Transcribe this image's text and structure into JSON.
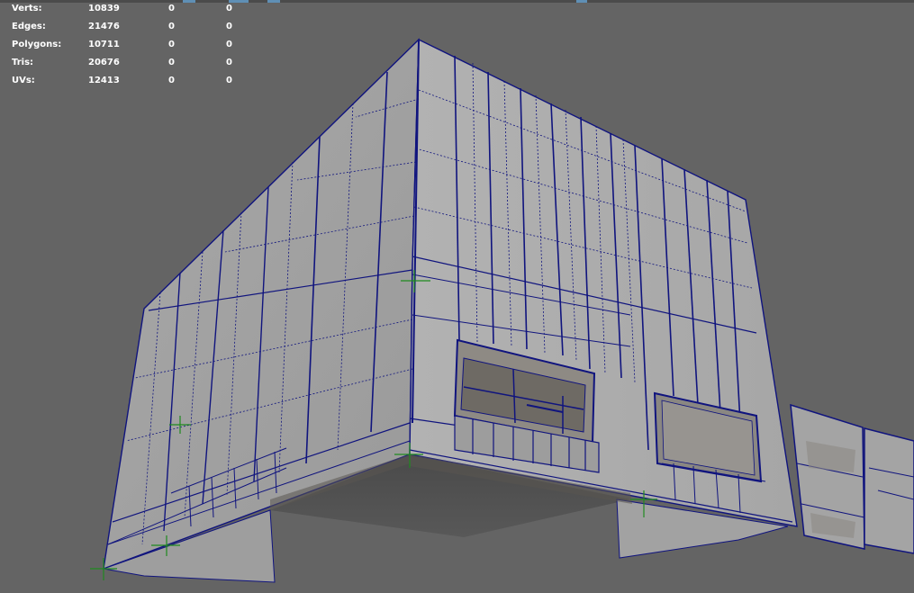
{
  "heads_up_display": {
    "rows": [
      {
        "label": "Verts:",
        "total": "10839",
        "selected": "0",
        "component": "0"
      },
      {
        "label": "Edges:",
        "total": "21476",
        "selected": "0",
        "component": "0"
      },
      {
        "label": "Polygons:",
        "total": "10711",
        "selected": "0",
        "component": "0"
      },
      {
        "label": "Tris:",
        "total": "20676",
        "selected": "0",
        "component": "0"
      },
      {
        "label": "UVs:",
        "total": "12413",
        "selected": "0",
        "component": "0"
      }
    ]
  },
  "viewport": {
    "background": "#646464",
    "wireframe_color": "#10147e",
    "surface_color": "#a3a3a3",
    "pivot_color": "#1f8a1f"
  }
}
